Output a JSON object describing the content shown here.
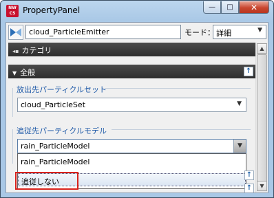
{
  "window": {
    "title": "PropertyPanel",
    "app_icon_text": "NW\nCS",
    "minimize_glyph": "—",
    "maximize_glyph": "□",
    "close_glyph": "✕"
  },
  "toolbar": {
    "emitter_name": "cloud_ParticleEmitter",
    "mode_label": "モード：",
    "mode_value": "詳細",
    "emitter_icon": "emitter-bowtie-icon"
  },
  "sections": {
    "category_header": "カテゴリ",
    "group_header": "全般"
  },
  "emit_target": {
    "label": "放出先パーティクルセット",
    "value": "cloud_ParticleSet"
  },
  "follow_target": {
    "label": "追従先パーティクルモデル",
    "value": "rain_ParticleModel",
    "options": [
      "rain_ParticleModel",
      "追従しない"
    ],
    "highlighted_option": "追従しない"
  },
  "colors": {
    "header_bg": "#2e2e2e",
    "label_blue": "#1f5aa8",
    "highlight_red": "#d9221c",
    "close_red": "#c9462f"
  }
}
